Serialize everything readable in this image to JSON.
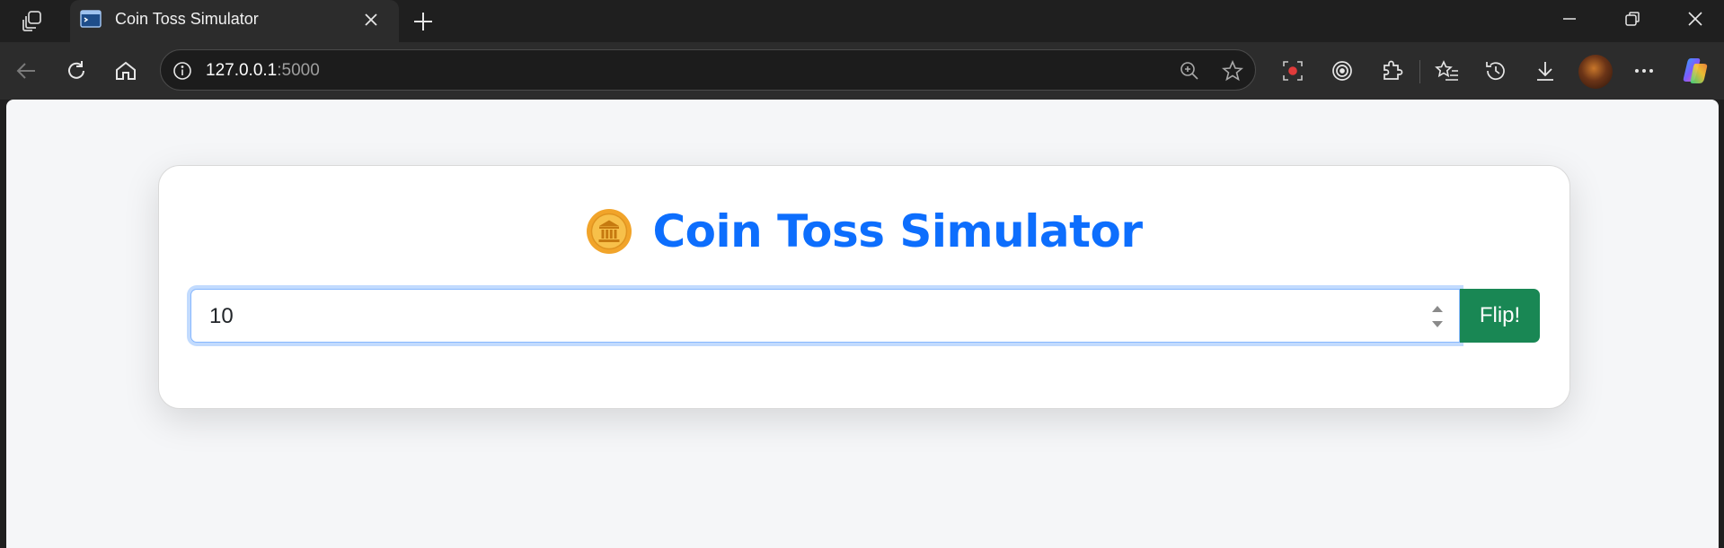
{
  "browser": {
    "tab": {
      "title": "Coin Toss Simulator"
    },
    "address": {
      "host": "127.0.0.1",
      "port": ":5000"
    }
  },
  "page": {
    "title": "Coin Toss Simulator",
    "icon": "coin-icon",
    "flips_input": {
      "value": "10"
    },
    "flip_button": {
      "label": "Flip!"
    },
    "colors": {
      "title": "#0d6efd",
      "button": "#198754"
    }
  }
}
